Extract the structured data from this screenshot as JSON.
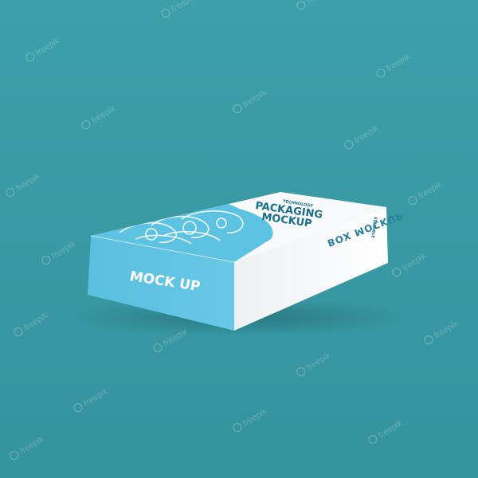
{
  "watermark": {
    "text": "freepik"
  },
  "box": {
    "front_label": "MOCK UP",
    "top_small": "TECHNOLOGY",
    "top_title_line1": "PACKAGING",
    "top_title_line2": "MOCKUP",
    "top_side_badge": "EDITABLE",
    "side_label": "BOX MOCKUP"
  },
  "colors": {
    "background": "#3a9ba6",
    "box_blue": "#5ec3e3",
    "box_white": "#f4f6f7",
    "text_dark": "#1a6d8a"
  }
}
